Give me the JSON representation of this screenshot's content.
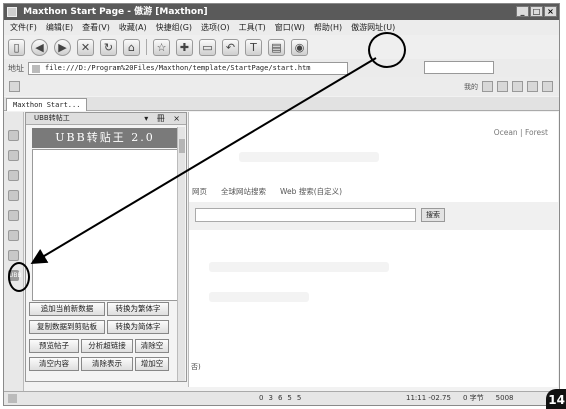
{
  "window": {
    "title": "Maxthon Start Page - 傲游 [Maxthon]",
    "controls": [
      "_",
      "□",
      "×"
    ]
  },
  "menu": [
    "文件(F)",
    "编辑(E)",
    "查看(V)",
    "收藏(A)",
    "快捷组(G)",
    "选项(O)",
    "工具(T)",
    "窗口(W)",
    "帮助(H)",
    "傲游网址(U)"
  ],
  "toolbar": {
    "icons": [
      "new-page-icon",
      "back-icon",
      "forward-icon",
      "stop-icon",
      "refresh-icon",
      "home-icon",
      "favorite-star-icon",
      "extensions-icon",
      "rss-icon",
      "undo-icon",
      "text-icon",
      "sidebar-icon",
      "rss-feed-icon"
    ]
  },
  "address": {
    "label": "地址",
    "url": "file:///D:/Program%20Files/Maxthon/template/StartPage/start.htm"
  },
  "linkbar": {
    "right_label": "我的"
  },
  "tab": {
    "label": "Maxthon Start..."
  },
  "sidepanel": {
    "header": "UBB转帖工",
    "controls": "▾ 冊 ×",
    "title": "UBB转贴王 2.0"
  },
  "buttons": [
    "追加当前新数据",
    "转换为繁体字",
    "复制数据到剪贴板",
    "转换为简体字",
    "预览帖子",
    "分析超链接",
    "清除空",
    "清空内容",
    "清除表示",
    "增加空"
  ],
  "side_icon_ubb_label": "UBB",
  "content": {
    "skin_links": "Ocean | Forest",
    "search_tabs": [
      "网页",
      "全球网站搜索",
      "Web 搜索(自定义)"
    ],
    "search_button": "搜索",
    "trailing_text": "否)"
  },
  "status": {
    "mid": [
      "0",
      "3",
      "6",
      "5",
      "5"
    ],
    "right": [
      "11:11 -02.75",
      "0 字节",
      "5008"
    ]
  },
  "figure_badge": "14"
}
